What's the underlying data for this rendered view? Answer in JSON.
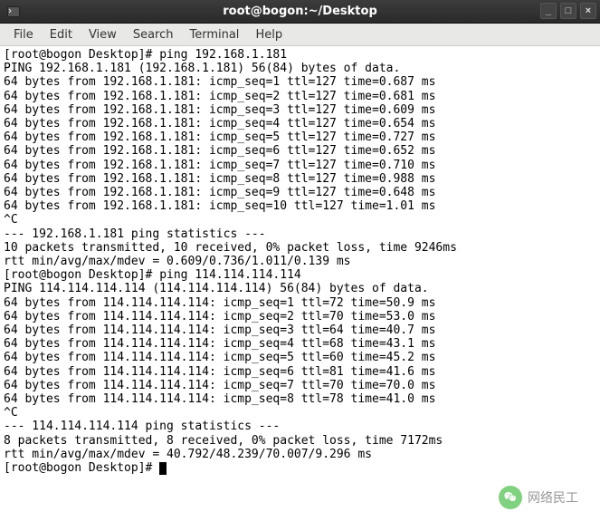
{
  "title": "root@bogon:~/Desktop",
  "menu": [
    "File",
    "Edit",
    "View",
    "Search",
    "Terminal",
    "Help"
  ],
  "prompt": "[root@bogon Desktop]# ",
  "cmd1": "ping 192.168.1.181",
  "ping1_header": "PING 192.168.1.181 (192.168.1.181) 56(84) bytes of data.",
  "ping1": [
    "64 bytes from 192.168.1.181: icmp_seq=1 ttl=127 time=0.687 ms",
    "64 bytes from 192.168.1.181: icmp_seq=2 ttl=127 time=0.681 ms",
    "64 bytes from 192.168.1.181: icmp_seq=3 ttl=127 time=0.609 ms",
    "64 bytes from 192.168.1.181: icmp_seq=4 ttl=127 time=0.654 ms",
    "64 bytes from 192.168.1.181: icmp_seq=5 ttl=127 time=0.727 ms",
    "64 bytes from 192.168.1.181: icmp_seq=6 ttl=127 time=0.652 ms",
    "64 bytes from 192.168.1.181: icmp_seq=7 ttl=127 time=0.710 ms",
    "64 bytes from 192.168.1.181: icmp_seq=8 ttl=127 time=0.988 ms",
    "64 bytes from 192.168.1.181: icmp_seq=9 ttl=127 time=0.648 ms",
    "64 bytes from 192.168.1.181: icmp_seq=10 ttl=127 time=1.01 ms"
  ],
  "ctrlc": "^C",
  "stats1_header": "--- 192.168.1.181 ping statistics ---",
  "stats1_line1": "10 packets transmitted, 10 received, 0% packet loss, time 9246ms",
  "stats1_line2": "rtt min/avg/max/mdev = 0.609/0.736/1.011/0.139 ms",
  "cmd2": "ping 114.114.114.114",
  "ping2_header": "PING 114.114.114.114 (114.114.114.114) 56(84) bytes of data.",
  "ping2": [
    "64 bytes from 114.114.114.114: icmp_seq=1 ttl=72 time=50.9 ms",
    "64 bytes from 114.114.114.114: icmp_seq=2 ttl=70 time=53.0 ms",
    "64 bytes from 114.114.114.114: icmp_seq=3 ttl=64 time=40.7 ms",
    "64 bytes from 114.114.114.114: icmp_seq=4 ttl=68 time=43.1 ms",
    "64 bytes from 114.114.114.114: icmp_seq=5 ttl=60 time=45.2 ms",
    "64 bytes from 114.114.114.114: icmp_seq=6 ttl=81 time=41.6 ms",
    "64 bytes from 114.114.114.114: icmp_seq=7 ttl=70 time=70.0 ms",
    "64 bytes from 114.114.114.114: icmp_seq=8 ttl=78 time=41.0 ms"
  ],
  "stats2_header": "--- 114.114.114.114 ping statistics ---",
  "stats2_line1": "8 packets transmitted, 8 received, 0% packet loss, time 7172ms",
  "stats2_line2": "rtt min/avg/max/mdev = 40.792/48.239/70.007/9.296 ms",
  "watermark": "网络民工"
}
